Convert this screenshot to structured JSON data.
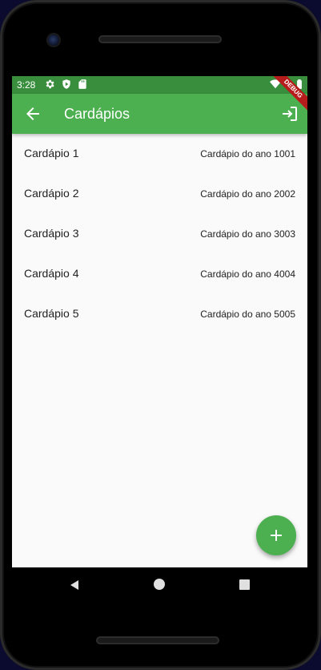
{
  "status_bar": {
    "time": "3:28",
    "icons": [
      "settings-icon",
      "play-protect-icon",
      "sd-card-icon",
      "wifi-icon",
      "battery-icon"
    ]
  },
  "app_bar": {
    "title": "Cardápios",
    "back_icon": "arrow-back-icon",
    "action_icon": "logout-icon",
    "debug_label": "DEBUG"
  },
  "list": {
    "items": [
      {
        "title": "Cardápio 1",
        "subtitle": "Cardápio do ano 1001"
      },
      {
        "title": "Cardápio 2",
        "subtitle": "Cardápio do ano 2002"
      },
      {
        "title": "Cardápio 3",
        "subtitle": "Cardápio do ano 3003"
      },
      {
        "title": "Cardápio 4",
        "subtitle": "Cardápio do ano 4004"
      },
      {
        "title": "Cardápio 5",
        "subtitle": "Cardápio do ano 5005"
      }
    ]
  },
  "fab": {
    "icon": "add-icon"
  },
  "colors": {
    "primary": "#4caf50",
    "primary_dark": "#388e3c",
    "background": "#fafafa",
    "debug_banner": "#b71c1c"
  },
  "nav_bar": {
    "icons": [
      "nav-back-icon",
      "nav-home-icon",
      "nav-recents-icon"
    ]
  }
}
